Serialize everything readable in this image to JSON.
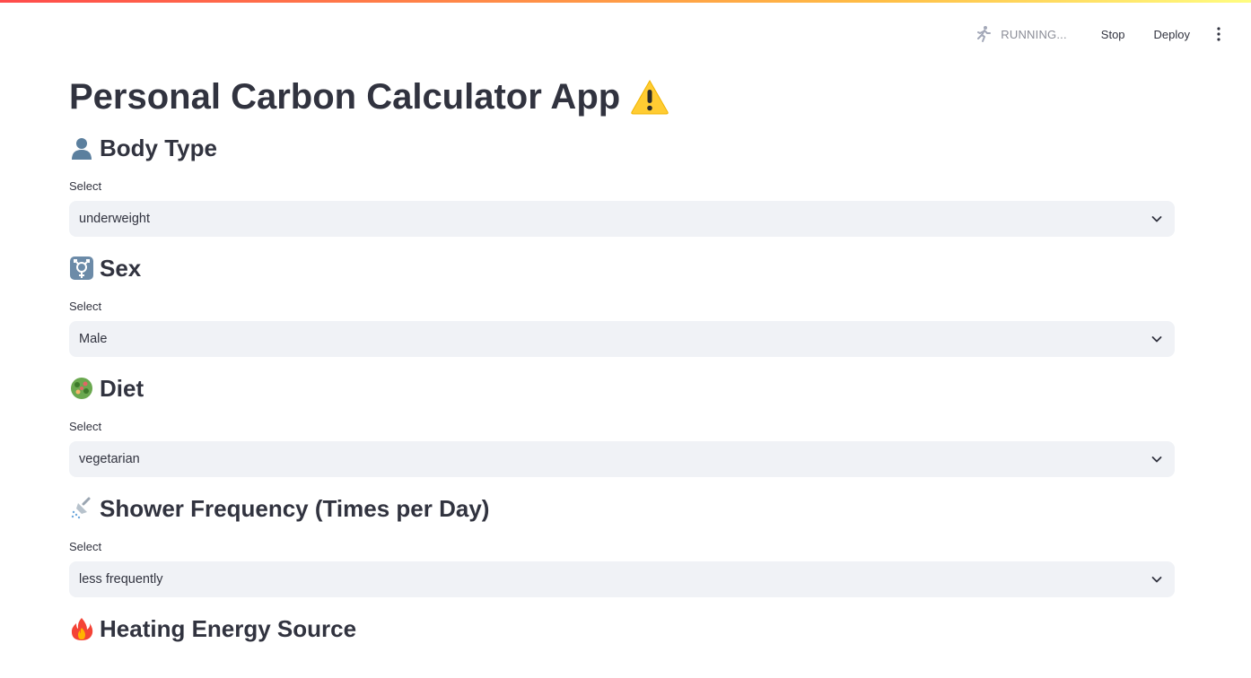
{
  "header": {
    "status_text": "RUNNING...",
    "stop_label": "Stop",
    "deploy_label": "Deploy",
    "status_icon": "running-person-icon",
    "menu_icon": "kebab-menu-icon"
  },
  "page": {
    "title": "Personal Carbon Calculator App",
    "title_icon": "warning-icon"
  },
  "sections": [
    {
      "heading": "Body Type",
      "icon": "bust-silhouette-icon",
      "label": "Select",
      "value": "underweight"
    },
    {
      "heading": "Sex",
      "icon": "transgender-symbol-icon",
      "label": "Select",
      "value": "Male"
    },
    {
      "heading": "Diet",
      "icon": "green-salad-icon",
      "label": "Select",
      "value": "vegetarian"
    },
    {
      "heading": "Shower Frequency (Times per Day)",
      "icon": "shower-icon",
      "label": "Select",
      "value": "less frequently"
    },
    {
      "heading": "Heating Energy Source",
      "icon": "fire-icon"
    }
  ],
  "colors": {
    "accent_start": "#ff4b4b",
    "accent_end": "#fffd80",
    "select_bg": "#f0f2f6",
    "text": "#31333f",
    "muted_text": "#8b8d97"
  }
}
